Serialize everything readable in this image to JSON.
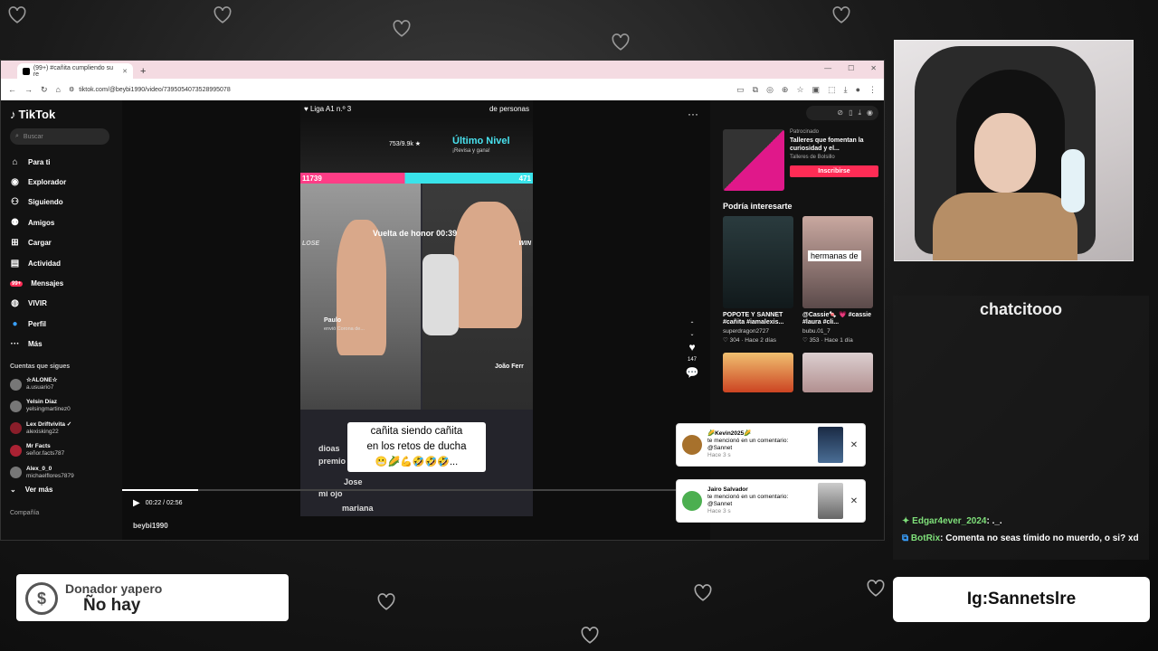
{
  "browser": {
    "tab_title": "(99+) #cañita cumpliendo su re",
    "url": "tiktok.com/@beybi1990/video/7395054073528995078"
  },
  "tiktok": {
    "logo": "TikTok",
    "search_placeholder": "Buscar",
    "nav": [
      {
        "label": "Para ti",
        "icon": "home-icon"
      },
      {
        "label": "Explorador",
        "icon": "compass-icon"
      },
      {
        "label": "Siguiendo",
        "icon": "following-icon"
      },
      {
        "label": "Amigos",
        "icon": "friends-icon"
      },
      {
        "label": "Cargar",
        "icon": "upload-icon"
      },
      {
        "label": "Actividad",
        "icon": "activity-icon"
      },
      {
        "label": "Mensajes",
        "icon": "messages-icon",
        "badge": "99+"
      },
      {
        "label": "VIVIR",
        "icon": "live-icon"
      },
      {
        "label": "Perfil",
        "icon": "profile-icon"
      },
      {
        "label": "Más",
        "icon": "more-icon"
      }
    ],
    "following_label": "Cuentas que sigues",
    "following": [
      {
        "name": "☆ALONE☆",
        "user": "a.usuario7"
      },
      {
        "name": "Yelsin Díaz",
        "user": "yelsingmartinez0"
      },
      {
        "name": "Lex Driftvivita ✓",
        "user": "alexisking22"
      },
      {
        "name": "Mr Facts",
        "user": "señor.facts787"
      },
      {
        "name": "Alex_0_0",
        "user": "michaelflores7879"
      }
    ],
    "see_more": "Ver más",
    "company": "Compañía",
    "video": {
      "top_left": "Liga A1 n.º 3",
      "top_right": "de personas",
      "counter": "753/9.9k",
      "nivel_title": "Último Nivel",
      "nivel_sub": "¡Revisa y gana!",
      "score_left": "11739",
      "score_right": "471",
      "lose": "LOSE",
      "win": "WIN",
      "vuelta": "Vuelta de honor 00:39",
      "gift_name": "Paulo",
      "gift_sub": "envió Corona de...",
      "joao": "João Ferr",
      "chat1": "dioas",
      "chat2": "premio",
      "chat3": "Jose",
      "chat4": "mi ojo",
      "chat5": "mariana",
      "caption_line1": "cañita siendo cañita",
      "caption_line2": "en los retos de ducha",
      "caption_emojis": "😬🌽💪🤣🤣🤣...",
      "time": "00:22 / 02:56",
      "author": "beybi1990",
      "likes": "147",
      "progress": 0.129
    },
    "right": {
      "sponsored_label": "Patrocinado",
      "sponsored_title": "Talleres que fomentan la curiosidad y el...",
      "sponsored_brand": "Talleres de Bolsillo",
      "sponsored_btn": "Inscribirse",
      "interest_title": "Podría interesarte",
      "cards": [
        {
          "title": "POPOTE Y SANNET #cañita #iamalexis...",
          "user": "superdragon2727",
          "meta": "♡ 304 · Hace 2 días"
        },
        {
          "title": "@Cassie🍬 💗 #cassie #laura #cli...",
          "user": "bubu.01_7",
          "meta": "♡ 353 · Hace 1 día"
        }
      ],
      "card2_overlay": "hermanas de"
    },
    "notifications": [
      {
        "name": "🌽Kevin2025🌽",
        "text": "te mencionó en un comentario: @Sannet",
        "ago": "Hace 3 s"
      },
      {
        "name": "Jairo Salvador",
        "text": "te mencionó en un comentario: @Sannet",
        "ago": "Hace 3 s"
      }
    ]
  },
  "overlay": {
    "chat_title": "chatcitooo",
    "chat_messages": [
      {
        "user": "Edgar4ever_2024",
        "text": ": ._."
      },
      {
        "user": "BotRix",
        "text": ": Comenta no seas tímido no muerdo, o si? xd"
      }
    ],
    "donor_title": "Donador yapero",
    "donor_value": "Ño hay",
    "ig": "Ig:Sannetslre"
  },
  "colors": {
    "accent": "#fe2c55",
    "score_pink": "#ff3d86",
    "score_cyan": "#39e3ea"
  }
}
